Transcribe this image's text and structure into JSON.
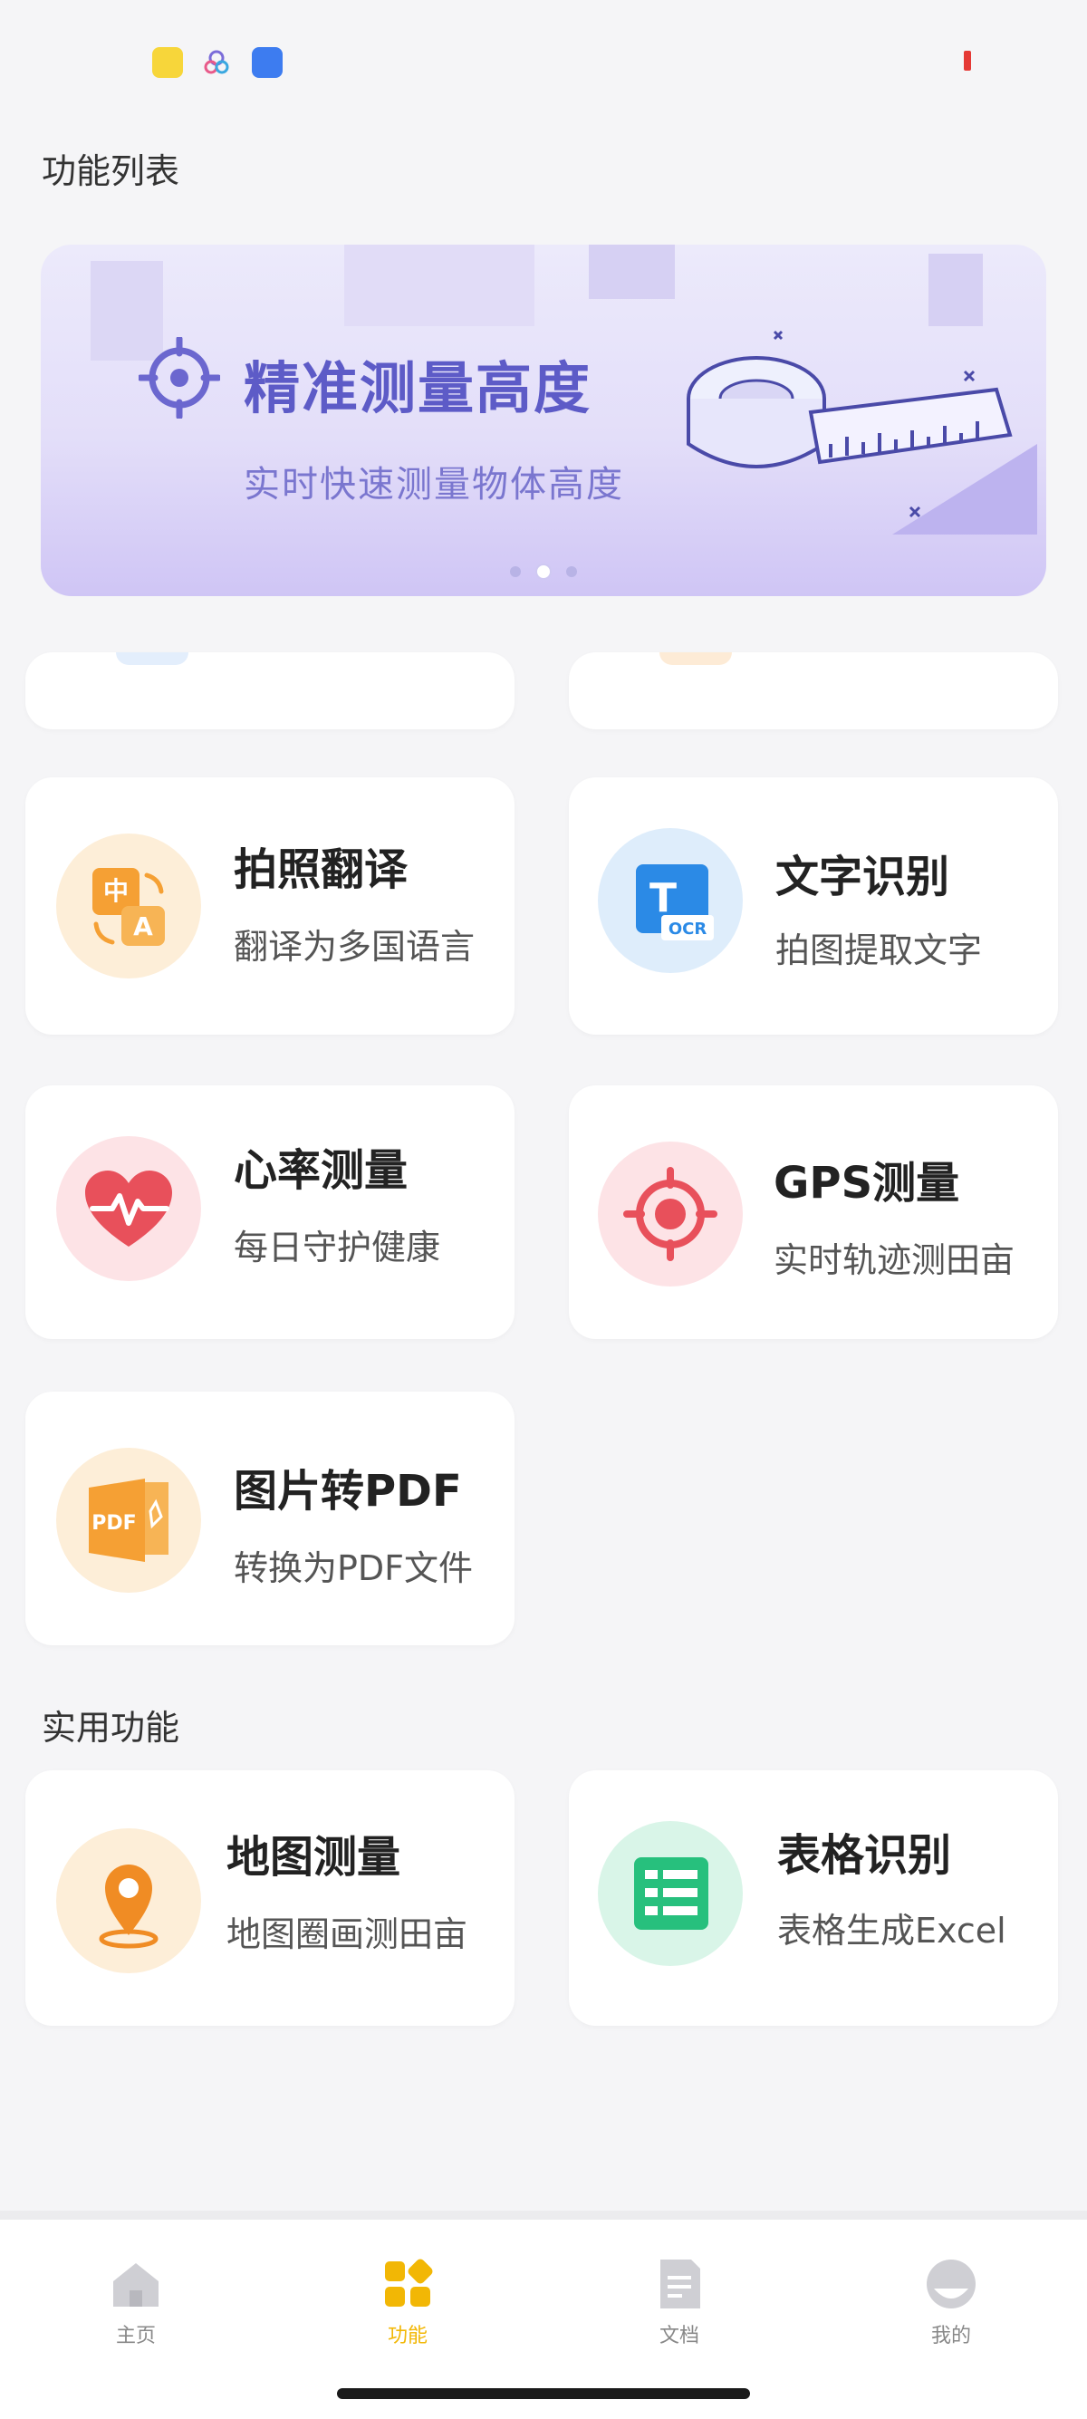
{
  "section_features": {
    "title": "功能列表"
  },
  "banner": {
    "title": "精准测量高度",
    "subtitle": "实时快速测量物体高度",
    "slide_count": 3,
    "active_slide": 2
  },
  "features": [
    {
      "title": "拍照翻译",
      "subtitle": "翻译为多国语言",
      "icon": "translate-icon"
    },
    {
      "title": "文字识别",
      "subtitle": "拍图提取文字",
      "icon": "ocr-icon"
    },
    {
      "title": "心率测量",
      "subtitle": "每日守护健康",
      "icon": "heart-rate-icon"
    },
    {
      "title": "GPS测量",
      "subtitle": "实时轨迹测田亩",
      "icon": "gps-target-icon"
    },
    {
      "title": "图片转PDF",
      "subtitle": "转换为PDF文件",
      "icon": "pdf-icon"
    }
  ],
  "section_tools": {
    "title": "实用功能"
  },
  "tools": [
    {
      "title": "地图测量",
      "subtitle": "地图圈画测田亩",
      "icon": "map-pin-icon"
    },
    {
      "title": "表格识别",
      "subtitle": "表格生成Excel",
      "icon": "table-icon"
    }
  ],
  "tabbar": {
    "items": [
      {
        "label": "主页",
        "icon": "home-icon"
      },
      {
        "label": "功能",
        "icon": "grid-icon",
        "active": true
      },
      {
        "label": "文档",
        "icon": "document-icon"
      },
      {
        "label": "我的",
        "icon": "profile-icon"
      }
    ]
  },
  "colors": {
    "accent": "#f2b705",
    "banner_text": "#5d5bc7",
    "heart": "#e8505b",
    "ocr_blue": "#2b8ae6",
    "excel_green": "#27c07d",
    "map_orange": "#f08c24"
  }
}
